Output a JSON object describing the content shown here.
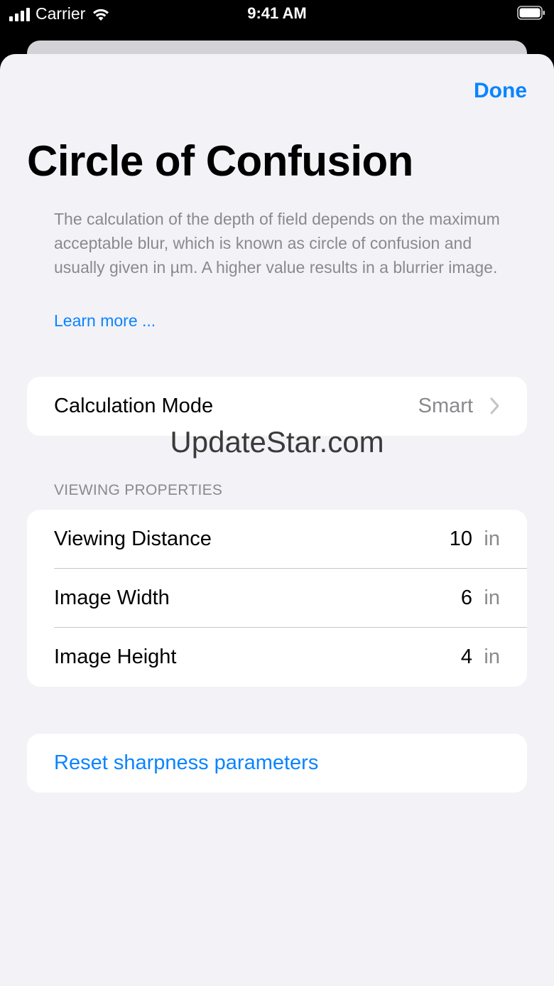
{
  "status_bar": {
    "carrier": "Carrier",
    "time": "9:41 AM"
  },
  "header": {
    "done_label": "Done",
    "title": "Circle of Confusion"
  },
  "description": {
    "text": "The calculation of the depth of field depends on the maximum acceptable blur, which is known as circle of confusion and usually given in µm. A higher value results in a blurrier image.",
    "learn_more": "Learn more ..."
  },
  "calculation_mode": {
    "label": "Calculation Mode",
    "value": "Smart"
  },
  "viewing_properties": {
    "header": "VIEWING PROPERTIES",
    "rows": [
      {
        "label": "Viewing Distance",
        "value": "10",
        "unit": "in"
      },
      {
        "label": "Image Width",
        "value": "6",
        "unit": "in"
      },
      {
        "label": "Image Height",
        "value": "4",
        "unit": "in"
      }
    ]
  },
  "reset": {
    "label": "Reset sharpness parameters"
  },
  "watermark": "UpdateStar.com",
  "colors": {
    "accent": "#0a84ff",
    "background": "#f2f2f7",
    "card": "#ffffff",
    "secondary_text": "#8a8a8e"
  },
  "icons": {
    "signal": "cellular-signal-icon",
    "wifi": "wifi-icon",
    "battery": "battery-icon",
    "chevron": "chevron-right-icon"
  }
}
